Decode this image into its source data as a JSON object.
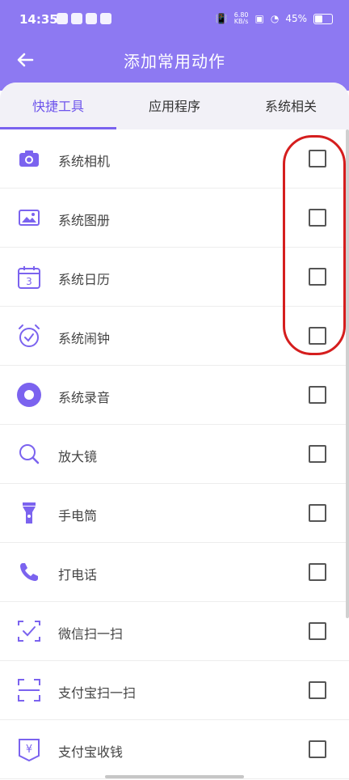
{
  "status_bar": {
    "time": "14:35",
    "network_speed": "6.80\nKB/s",
    "battery": "45%"
  },
  "header": {
    "title": "添加常用动作"
  },
  "tabs": [
    {
      "label": "快捷工具",
      "active": true
    },
    {
      "label": "应用程序",
      "active": false
    },
    {
      "label": "系统相关",
      "active": false
    }
  ],
  "items": [
    {
      "label": "系统相机",
      "icon": "camera-icon",
      "checked": false
    },
    {
      "label": "系统图册",
      "icon": "gallery-icon",
      "checked": false
    },
    {
      "label": "系统日历",
      "icon": "calendar-icon",
      "checked": false
    },
    {
      "label": "系统闹钟",
      "icon": "alarm-icon",
      "checked": false
    },
    {
      "label": "系统录音",
      "icon": "recorder-icon",
      "checked": false
    },
    {
      "label": "放大镜",
      "icon": "magnifier-icon",
      "checked": false
    },
    {
      "label": "手电筒",
      "icon": "flashlight-icon",
      "checked": false
    },
    {
      "label": "打电话",
      "icon": "phone-icon",
      "checked": false
    },
    {
      "label": "微信扫一扫",
      "icon": "wechat-scan-icon",
      "checked": false
    },
    {
      "label": "支付宝扫一扫",
      "icon": "alipay-scan-icon",
      "checked": false
    },
    {
      "label": "支付宝收钱",
      "icon": "alipay-receive-icon",
      "checked": false
    }
  ],
  "colors": {
    "accent": "#8d79f2",
    "highlight": "#d51e1e"
  }
}
